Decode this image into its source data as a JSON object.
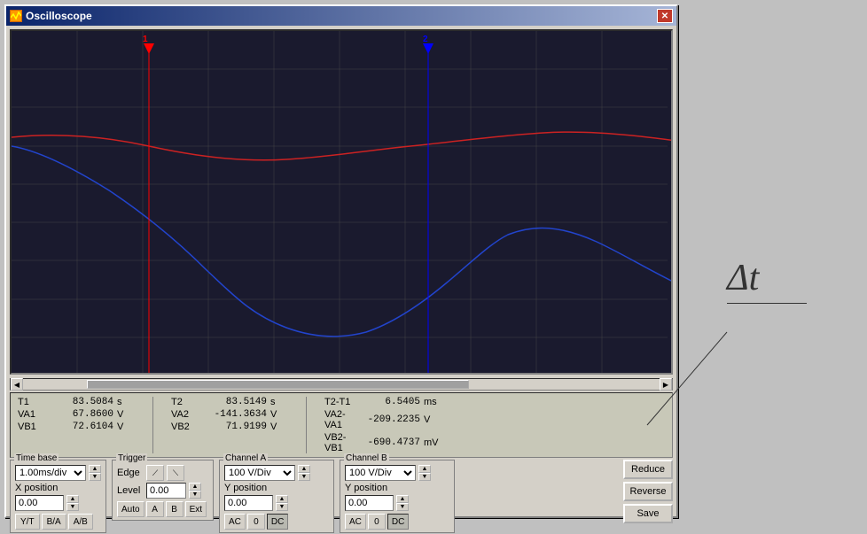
{
  "window": {
    "title": "Oscilloscope",
    "close_label": "✕"
  },
  "measurements": {
    "t1_label": "T1",
    "t1_value": "83.5084",
    "t1_unit": "s",
    "va1_label": "VA1",
    "va1_value": "67.8600",
    "va1_unit": "V",
    "vb1_label": "VB1",
    "vb1_value": "72.6104",
    "vb1_unit": "V",
    "t2_label": "T2",
    "t2_value": "83.5149",
    "t2_unit": "s",
    "va2_label": "VA2",
    "va2_value": "-141.3634",
    "va2_unit": "V",
    "vb2_label": "VB2",
    "vb2_value": "71.9199",
    "vb2_unit": "V",
    "t2t1_label": "T2-T1",
    "t2t1_value": "6.5405",
    "t2t1_unit": "ms",
    "va2va1_label": "VA2-VA1",
    "va2va1_value": "-209.2235",
    "va2va1_unit": "V",
    "vb2vb1_label": "VB2-VB1",
    "vb2vb1_value": "-690.4737",
    "vb2vb1_unit": "mV"
  },
  "timebase": {
    "label": "Time base",
    "value": "1.00ms/div",
    "xpos_label": "X position",
    "xpos_value": "0.00"
  },
  "trigger": {
    "label": "Trigger",
    "edge_label": "Edge",
    "level_label": "Level",
    "level_value": "0.00",
    "auto_label": "Auto",
    "a_label": "A",
    "b_label": "B",
    "ext_label": "Ext"
  },
  "channel_a": {
    "label": "Channel A",
    "value": "100 V/Div",
    "ypos_label": "Y position",
    "ypos_value": "0.00",
    "ac_label": "AC",
    "dc_label": "DC",
    "zero_label": "0"
  },
  "channel_b": {
    "label": "Channel B",
    "value": "100 V/Div",
    "ypos_label": "Y position",
    "ypos_value": "0.00",
    "ac_label": "AC",
    "dc_label": "DC",
    "zero_label": "0"
  },
  "mode_buttons": {
    "yt": "Y/T",
    "ba": "B/A",
    "ab": "A/B"
  },
  "action_buttons": {
    "reduce": "Reduce",
    "reverse": "Reverse",
    "save": "Save"
  },
  "cursor1_label": "1",
  "cursor2_label": "2",
  "delta_t": "Δt"
}
